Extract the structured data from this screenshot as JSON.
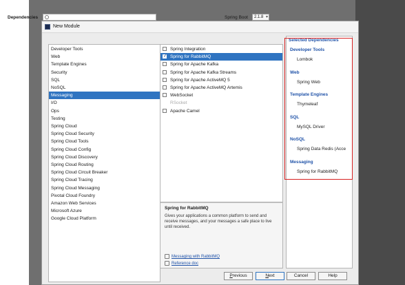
{
  "dialog": {
    "title": "New Module"
  },
  "header": {
    "dependencies_label": "Dependencies",
    "search": {
      "value": "",
      "placeholder": ""
    },
    "spring_boot_label": "Spring Boot",
    "spring_boot_version": "2.1.8"
  },
  "categories": [
    {
      "label": "Developer Tools"
    },
    {
      "label": "Web"
    },
    {
      "label": "Template Engines"
    },
    {
      "label": "Security"
    },
    {
      "label": "SQL"
    },
    {
      "label": "NoSQL"
    },
    {
      "label": "Messaging",
      "selected": true
    },
    {
      "label": "I/O"
    },
    {
      "label": "Ops"
    },
    {
      "label": "Testing"
    },
    {
      "label": "Spring Cloud"
    },
    {
      "label": "Spring Cloud Security"
    },
    {
      "label": "Spring Cloud Tools"
    },
    {
      "label": "Spring Cloud Config"
    },
    {
      "label": "Spring Cloud Discovery"
    },
    {
      "label": "Spring Cloud Routing"
    },
    {
      "label": "Spring Cloud Circuit Breaker"
    },
    {
      "label": "Spring Cloud Tracing"
    },
    {
      "label": "Spring Cloud Messaging"
    },
    {
      "label": "Pivotal Cloud Foundry"
    },
    {
      "label": "Amazon Web Services"
    },
    {
      "label": "Microsoft Azure"
    },
    {
      "label": "Google Cloud Platform"
    }
  ],
  "dependencies": [
    {
      "label": "Spring Integration",
      "checked": false,
      "checkbox": true
    },
    {
      "label": "Spring for RabbitMQ",
      "checked": true,
      "checkbox": true,
      "selected": true
    },
    {
      "label": "Spring for Apache Kafka",
      "checked": false,
      "checkbox": true
    },
    {
      "label": "Spring for Apache Kafka Streams",
      "checked": false,
      "checkbox": true
    },
    {
      "label": "Spring for Apache ActiveMQ 5",
      "checked": false,
      "checkbox": true
    },
    {
      "label": "Spring for Apache ActiveMQ Artemis",
      "checked": false,
      "checkbox": true
    },
    {
      "label": "WebSocket",
      "checked": false,
      "checkbox": true
    },
    {
      "label": "RSocket",
      "checked": false,
      "checkbox": false,
      "disabled": true
    },
    {
      "label": "Apache Camel",
      "checked": false,
      "checkbox": true
    }
  ],
  "description": {
    "title": "Spring for RabbitMQ",
    "body": "Gives your applications a common platform to send and receive messages, and your messages a safe place to live until received.",
    "links": [
      {
        "label": "Messaging with RabbitMQ",
        "icon": "guide-icon"
      },
      {
        "label": "Reference doc",
        "icon": "reference-icon"
      }
    ]
  },
  "selected": {
    "header": "Selected Dependencies",
    "groups": [
      {
        "name": "Developer Tools",
        "items": [
          "Lombok"
        ]
      },
      {
        "name": "Web",
        "items": [
          "Spring Web"
        ]
      },
      {
        "name": "Template Engines",
        "items": [
          "Thymeleaf"
        ]
      },
      {
        "name": "SQL",
        "items": [
          "MySQL Driver"
        ]
      },
      {
        "name": "NoSQL",
        "items": [
          "Spring Data Redis (Acce"
        ]
      },
      {
        "name": "Messaging",
        "items": [
          "Spring for RabbitMQ"
        ]
      }
    ]
  },
  "buttons": {
    "previous": {
      "mn": "P",
      "rest": "revious"
    },
    "next": {
      "mn": "N",
      "rest": "ext"
    },
    "cancel": {
      "label": "Cancel"
    },
    "help": {
      "label": "Help"
    }
  },
  "colors": {
    "accent": "#2f74c1",
    "highlight": "#d62020",
    "link": "#1f52a8"
  }
}
